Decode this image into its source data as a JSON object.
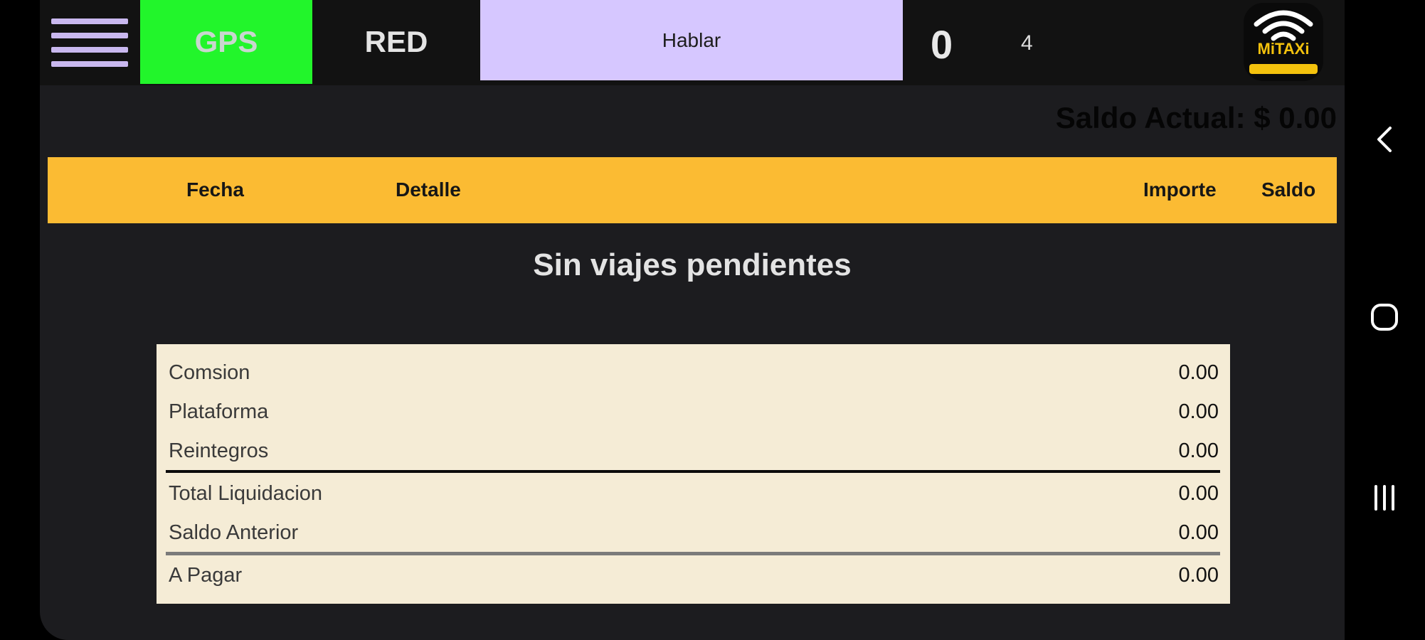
{
  "topbar": {
    "menu_icon": "hamburger-icon",
    "gps_label": "GPS",
    "red_label": "RED",
    "hablar_label": "Hablar",
    "count_main": "0",
    "count_secondary": "4",
    "logo_text": "MiTAXi",
    "logo_icon": "wifi-signal-icon"
  },
  "balance": {
    "current_label": "Saldo Actual: $ 0.00"
  },
  "table": {
    "headers": [
      "Fecha",
      "Detalle",
      "Importe",
      "Saldo"
    ],
    "empty_message": "Sin viajes pendientes"
  },
  "summary": {
    "rows": [
      {
        "label": "Comsion",
        "value": "0.00"
      },
      {
        "label": "Plataforma",
        "value": "0.00"
      },
      {
        "label": "Reintegros",
        "value": "0.00"
      },
      {
        "label": "Total Liquidacion",
        "value": "0.00"
      },
      {
        "label": "Saldo Anterior",
        "value": "0.00"
      },
      {
        "label": "A Pagar",
        "value": "0.00"
      }
    ]
  },
  "navigation": {
    "back_icon": "back-chevron-icon",
    "home_icon": "home-circle-icon",
    "recents_icon": "recent-apps-icon"
  },
  "colors": {
    "gps_active": "#22f52b",
    "hablar_bg": "#d6c7ff",
    "header_bg": "#fbbb33",
    "summary_bg": "#f5ecd6",
    "app_bg": "#1c1c1f"
  }
}
